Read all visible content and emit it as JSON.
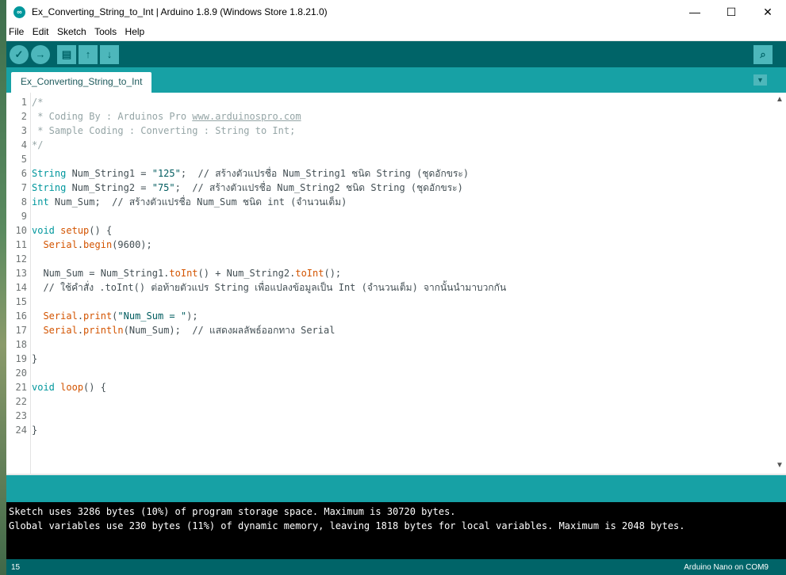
{
  "window": {
    "title": "Ex_Converting_String_to_Int | Arduino 1.8.9 (Windows Store 1.8.21.0)",
    "controls": {
      "minimize": "—",
      "maximize": "☐",
      "close": "✕"
    }
  },
  "menu": [
    "File",
    "Edit",
    "Sketch",
    "Tools",
    "Help"
  ],
  "toolbar": {
    "verify": "✓",
    "upload": "→",
    "new": "▤",
    "open": "↑",
    "save": "↓",
    "serial_monitor": "⌕"
  },
  "tabs": [
    {
      "label": "Ex_Converting_String_to_Int"
    }
  ],
  "tab_menu": "▼",
  "editor": {
    "lines": [
      {
        "n": "1",
        "tokens": [
          {
            "t": "/*",
            "c": "cm"
          }
        ]
      },
      {
        "n": "2",
        "tokens": [
          {
            "t": " * Coding By : Arduinos Pro ",
            "c": "cm"
          },
          {
            "t": "www.arduinospro.com",
            "c": "link"
          }
        ]
      },
      {
        "n": "3",
        "tokens": [
          {
            "t": " * Sample Coding : Converting : String to Int;",
            "c": "cm"
          }
        ]
      },
      {
        "n": "4",
        "tokens": [
          {
            "t": "*/",
            "c": "cm"
          }
        ]
      },
      {
        "n": "5",
        "tokens": []
      },
      {
        "n": "6",
        "tokens": [
          {
            "t": "String",
            "c": "ty"
          },
          {
            "t": " Num_String1 = ",
            "c": ""
          },
          {
            "t": "\"125\"",
            "c": "st"
          },
          {
            "t": ";  // สร้างตัวแปรชื่อ Num_String1 ชนิด String (ชุดอักขระ)",
            "c": ""
          }
        ]
      },
      {
        "n": "7",
        "tokens": [
          {
            "t": "String",
            "c": "ty"
          },
          {
            "t": " Num_String2 = ",
            "c": ""
          },
          {
            "t": "\"75\"",
            "c": "st"
          },
          {
            "t": ";  // สร้างตัวแปรชื่อ Num_String2 ชนิด String (ชุดอักขระ)",
            "c": ""
          }
        ]
      },
      {
        "n": "8",
        "tokens": [
          {
            "t": "int",
            "c": "ty"
          },
          {
            "t": " Num_Sum;  // สร้างตัวแปรชื่อ Num_Sum ชนิด int (จำนวนเต็ม)",
            "c": ""
          }
        ]
      },
      {
        "n": "9",
        "tokens": []
      },
      {
        "n": "10",
        "tokens": [
          {
            "t": "void",
            "c": "ty"
          },
          {
            "t": " ",
            "c": ""
          },
          {
            "t": "setup",
            "c": "fn"
          },
          {
            "t": "() {",
            "c": ""
          }
        ]
      },
      {
        "n": "11",
        "tokens": [
          {
            "t": "  ",
            "c": ""
          },
          {
            "t": "Serial",
            "c": "fn"
          },
          {
            "t": ".",
            "c": ""
          },
          {
            "t": "begin",
            "c": "fn"
          },
          {
            "t": "(9600);",
            "c": ""
          }
        ]
      },
      {
        "n": "12",
        "tokens": []
      },
      {
        "n": "13",
        "tokens": [
          {
            "t": "  Num_Sum = Num_String1.",
            "c": ""
          },
          {
            "t": "toInt",
            "c": "fn"
          },
          {
            "t": "() + Num_String2.",
            "c": ""
          },
          {
            "t": "toInt",
            "c": "fn"
          },
          {
            "t": "();",
            "c": ""
          }
        ]
      },
      {
        "n": "14",
        "tokens": [
          {
            "t": "  // ใช้คำสั่ง .toInt() ต่อท้ายตัวแปร String เพื่อแปลงข้อมูลเป็น Int (จำนวนเต็ม) จากนั้นนำมาบวกกัน",
            "c": ""
          }
        ]
      },
      {
        "n": "15",
        "tokens": []
      },
      {
        "n": "16",
        "tokens": [
          {
            "t": "  ",
            "c": ""
          },
          {
            "t": "Serial",
            "c": "fn"
          },
          {
            "t": ".",
            "c": ""
          },
          {
            "t": "print",
            "c": "fn"
          },
          {
            "t": "(",
            "c": ""
          },
          {
            "t": "\"Num_Sum = \"",
            "c": "st"
          },
          {
            "t": ");",
            "c": ""
          }
        ]
      },
      {
        "n": "17",
        "tokens": [
          {
            "t": "  ",
            "c": ""
          },
          {
            "t": "Serial",
            "c": "fn"
          },
          {
            "t": ".",
            "c": ""
          },
          {
            "t": "println",
            "c": "fn"
          },
          {
            "t": "(Num_Sum);  // แสดงผลลัพธ์ออกทาง Serial",
            "c": ""
          }
        ]
      },
      {
        "n": "18",
        "tokens": []
      },
      {
        "n": "19",
        "tokens": [
          {
            "t": "}",
            "c": ""
          }
        ]
      },
      {
        "n": "20",
        "tokens": []
      },
      {
        "n": "21",
        "tokens": [
          {
            "t": "void",
            "c": "ty"
          },
          {
            "t": " ",
            "c": ""
          },
          {
            "t": "loop",
            "c": "fn"
          },
          {
            "t": "() {",
            "c": ""
          }
        ]
      },
      {
        "n": "22",
        "tokens": []
      },
      {
        "n": "23",
        "tokens": []
      },
      {
        "n": "24",
        "tokens": [
          {
            "t": "}",
            "c": ""
          }
        ]
      }
    ]
  },
  "console": {
    "line1": "Sketch uses 3286 bytes (10%) of program storage space. Maximum is 30720 bytes.",
    "line2": "Global variables use 230 bytes (11%) of dynamic memory, leaving 1818 bytes for local variables. Maximum is 2048 bytes."
  },
  "status": {
    "line_number": "15",
    "board": "Arduino Nano on COM9"
  },
  "colors": {
    "teal_dark": "#006468",
    "teal": "#17a1a5",
    "keyword": "#00979d",
    "function": "#d35400",
    "comment": "#95a5a6"
  }
}
